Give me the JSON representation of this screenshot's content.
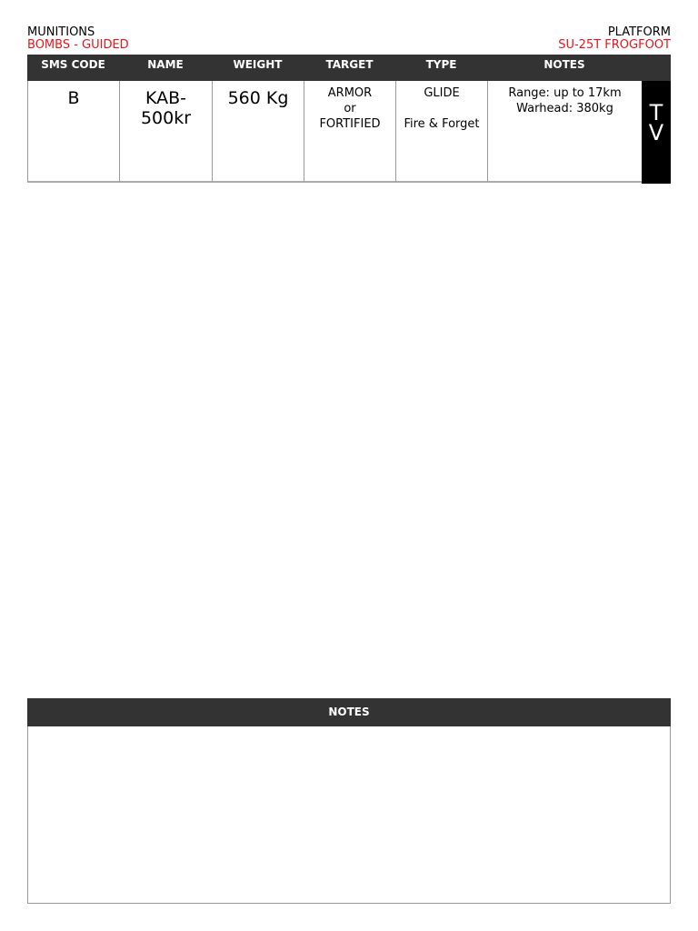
{
  "header": {
    "left_label": "MUNITIONS",
    "left_value": "BOMBS - GUIDED",
    "right_label": "PLATFORM",
    "right_value": "SU-25T FROGFOOT"
  },
  "columns": [
    "SMS CODE",
    "NAME",
    "WEIGHT",
    "TARGET",
    "TYPE",
    "NOTES"
  ],
  "row": {
    "sms_code": "B",
    "name_1": "KAB-",
    "name_2": "500kr",
    "weight": "560 Kg",
    "target_1": "ARMOR",
    "target_2": "or",
    "target_3": "FORTIFIED",
    "type_1": "GLIDE",
    "type_2": "Fire & Forget",
    "notes_1": "Range: up to 17km",
    "notes_2": "Warhead: 380kg",
    "guidance_1": "T",
    "guidance_2": "V"
  },
  "notes_section": {
    "title": "NOTES"
  }
}
